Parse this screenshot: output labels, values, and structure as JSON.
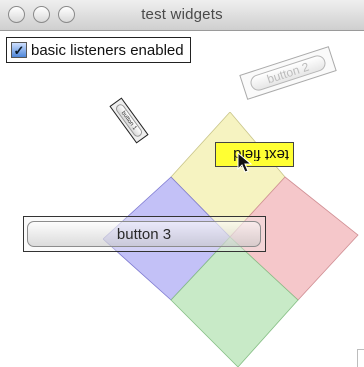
{
  "window": {
    "title": "test widgets"
  },
  "listeners": {
    "label": "basic listeners enabled",
    "checked": true
  },
  "buttons": {
    "button1": "button 1",
    "button2": "button 2",
    "button3": "button 3"
  },
  "text_field": {
    "value": "text field"
  },
  "colors": {
    "yellow_square": "#f4efb0",
    "red_square": "#f1b3b7",
    "blue_square": "#a9a6f3",
    "green_square": "#b5e3b4",
    "text_field_bg": "#ffff33"
  }
}
